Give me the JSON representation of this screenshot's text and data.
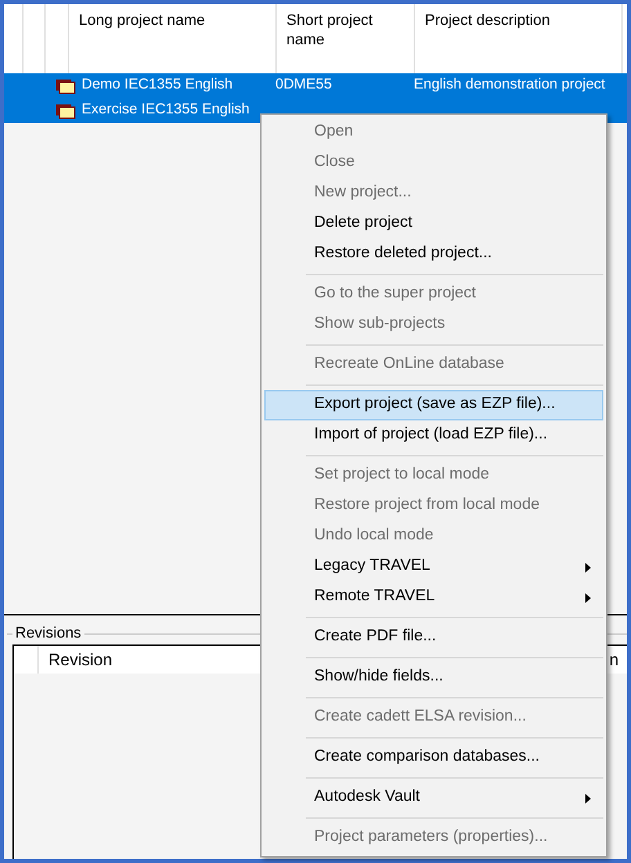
{
  "table": {
    "columns": [
      "Long project name",
      "Short project name",
      "Project description"
    ],
    "rows": [
      {
        "long_name": "Demo IEC1355 English",
        "short_name": "0DME55",
        "description": "English demonstration project",
        "selected": true
      },
      {
        "long_name": "Exercise IEC1355 English",
        "selected": true
      }
    ]
  },
  "revisions": {
    "title": "Revisions",
    "columns": [
      "Revision",
      "n"
    ]
  },
  "context_menu": [
    {
      "kind": "item",
      "label": "Open",
      "disabled": true,
      "selected": false
    },
    {
      "kind": "item",
      "label": "Close",
      "disabled": true,
      "selected": false
    },
    {
      "kind": "item",
      "label": "New project...",
      "disabled": true,
      "selected": false
    },
    {
      "kind": "item",
      "label": "Delete project",
      "disabled": false,
      "selected": false
    },
    {
      "kind": "item",
      "label": "Restore deleted project...",
      "disabled": false,
      "selected": false
    },
    {
      "kind": "separator"
    },
    {
      "kind": "item",
      "label": "Go to the super project",
      "disabled": true,
      "selected": false
    },
    {
      "kind": "item",
      "label": "Show sub-projects",
      "disabled": true,
      "selected": false
    },
    {
      "kind": "separator"
    },
    {
      "kind": "item",
      "label": "Recreate OnLine database",
      "disabled": true,
      "selected": false
    },
    {
      "kind": "separator"
    },
    {
      "kind": "item",
      "label": "Export project (save as EZP file)...",
      "disabled": false,
      "selected": true
    },
    {
      "kind": "item",
      "label": "Import of project (load EZP file)...",
      "disabled": false,
      "selected": false
    },
    {
      "kind": "separator"
    },
    {
      "kind": "item",
      "label": "Set project to local mode",
      "disabled": true,
      "selected": false
    },
    {
      "kind": "item",
      "label": "Restore project from local mode",
      "disabled": true,
      "selected": false
    },
    {
      "kind": "item",
      "label": "Undo local mode",
      "disabled": true,
      "selected": false
    },
    {
      "kind": "submenu",
      "label": "Legacy TRAVEL",
      "disabled": false,
      "selected": false
    },
    {
      "kind": "submenu",
      "label": "Remote TRAVEL",
      "disabled": false,
      "selected": false
    },
    {
      "kind": "separator"
    },
    {
      "kind": "item",
      "label": "Create PDF file...",
      "disabled": false,
      "selected": false
    },
    {
      "kind": "separator"
    },
    {
      "kind": "item",
      "label": "Show/hide fields...",
      "disabled": false,
      "selected": false
    },
    {
      "kind": "separator"
    },
    {
      "kind": "item",
      "label": "Create cadett ELSA revision...",
      "disabled": true,
      "selected": false
    },
    {
      "kind": "separator"
    },
    {
      "kind": "item",
      "label": "Create comparison databases...",
      "disabled": false,
      "selected": false
    },
    {
      "kind": "separator"
    },
    {
      "kind": "submenu",
      "label": "Autodesk Vault",
      "disabled": false,
      "selected": false
    },
    {
      "kind": "separator"
    },
    {
      "kind": "item",
      "label": "Project parameters (properties)...",
      "disabled": true,
      "selected": false
    }
  ]
}
